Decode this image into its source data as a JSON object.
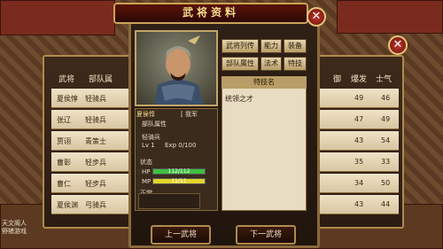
{
  "dialog": {
    "title": "武将资料",
    "close": "✕"
  },
  "list": {
    "close": "✕",
    "headers": {
      "general": "武将",
      "unit": "部队属",
      "col_defense": "御",
      "col_burst": "爆发",
      "col_morale": "士气"
    },
    "rows": [
      {
        "name": "夏侯惇",
        "unit": "轻骑兵",
        "burst": "49",
        "morale": "46"
      },
      {
        "name": "张辽",
        "unit": "轻骑兵",
        "burst": "47",
        "morale": "49"
      },
      {
        "name": "贾诩",
        "unit": "青策士",
        "burst": "43",
        "morale": "54"
      },
      {
        "name": "曹彰",
        "unit": "轻步兵",
        "burst": "35",
        "morale": "33"
      },
      {
        "name": "曹仁",
        "unit": "轻步兵",
        "burst": "34",
        "morale": "50"
      },
      {
        "name": "夏侯渊",
        "unit": "弓骑兵",
        "burst": "43",
        "morale": "44"
      }
    ]
  },
  "hero": {
    "name": "夏侯惇",
    "faction": "[ 我军",
    "unit_attr_label": "部队属性",
    "unit_type": "轻骑兵",
    "level": "Lv 1",
    "exp": "Exp 0/100",
    "status_label": "状态",
    "hp_label": "HP",
    "hp_value": "112/112",
    "hp_fraction": 1.0,
    "mp_label": "MP",
    "mp_value": "11/11",
    "mp_fraction": 1.0,
    "condition": "正常"
  },
  "tabs": {
    "bio": "武将列传",
    "ability": "能力",
    "equip": "装备",
    "unit_attr": "部队属性",
    "tactics": "法术",
    "skills": "特技"
  },
  "skills": {
    "header": "特技名",
    "items": [
      "统领之才"
    ]
  },
  "nav": {
    "prev": "上一武将",
    "next": "下一武将"
  },
  "watermark": {
    "line1": "天文阁人",
    "line2": "野猪游戏"
  },
  "colors": {
    "hp_bar": "#3fbf3f",
    "mp_bar": "#e3d42b",
    "accent_gold": "#c9a455"
  }
}
